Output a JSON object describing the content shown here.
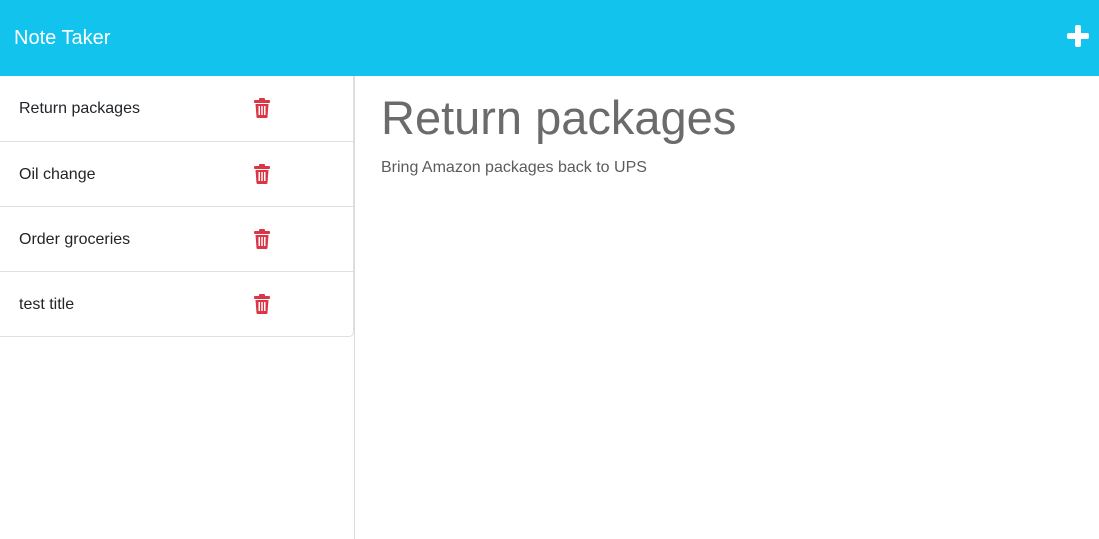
{
  "app": {
    "brand": "Note Taker",
    "accent_color": "#12c3ee",
    "delete_color": "#dc3545",
    "new_note_icon": "plus-icon"
  },
  "notes": [
    {
      "title": "Return packages",
      "icon": "trash-icon"
    },
    {
      "title": "Oil change",
      "icon": "trash-icon"
    },
    {
      "title": "Order groceries",
      "icon": "trash-icon"
    },
    {
      "title": "test title",
      "icon": "trash-icon"
    }
  ],
  "active_note": {
    "title": "Return packages",
    "text": "Bring Amazon packages back to UPS"
  }
}
